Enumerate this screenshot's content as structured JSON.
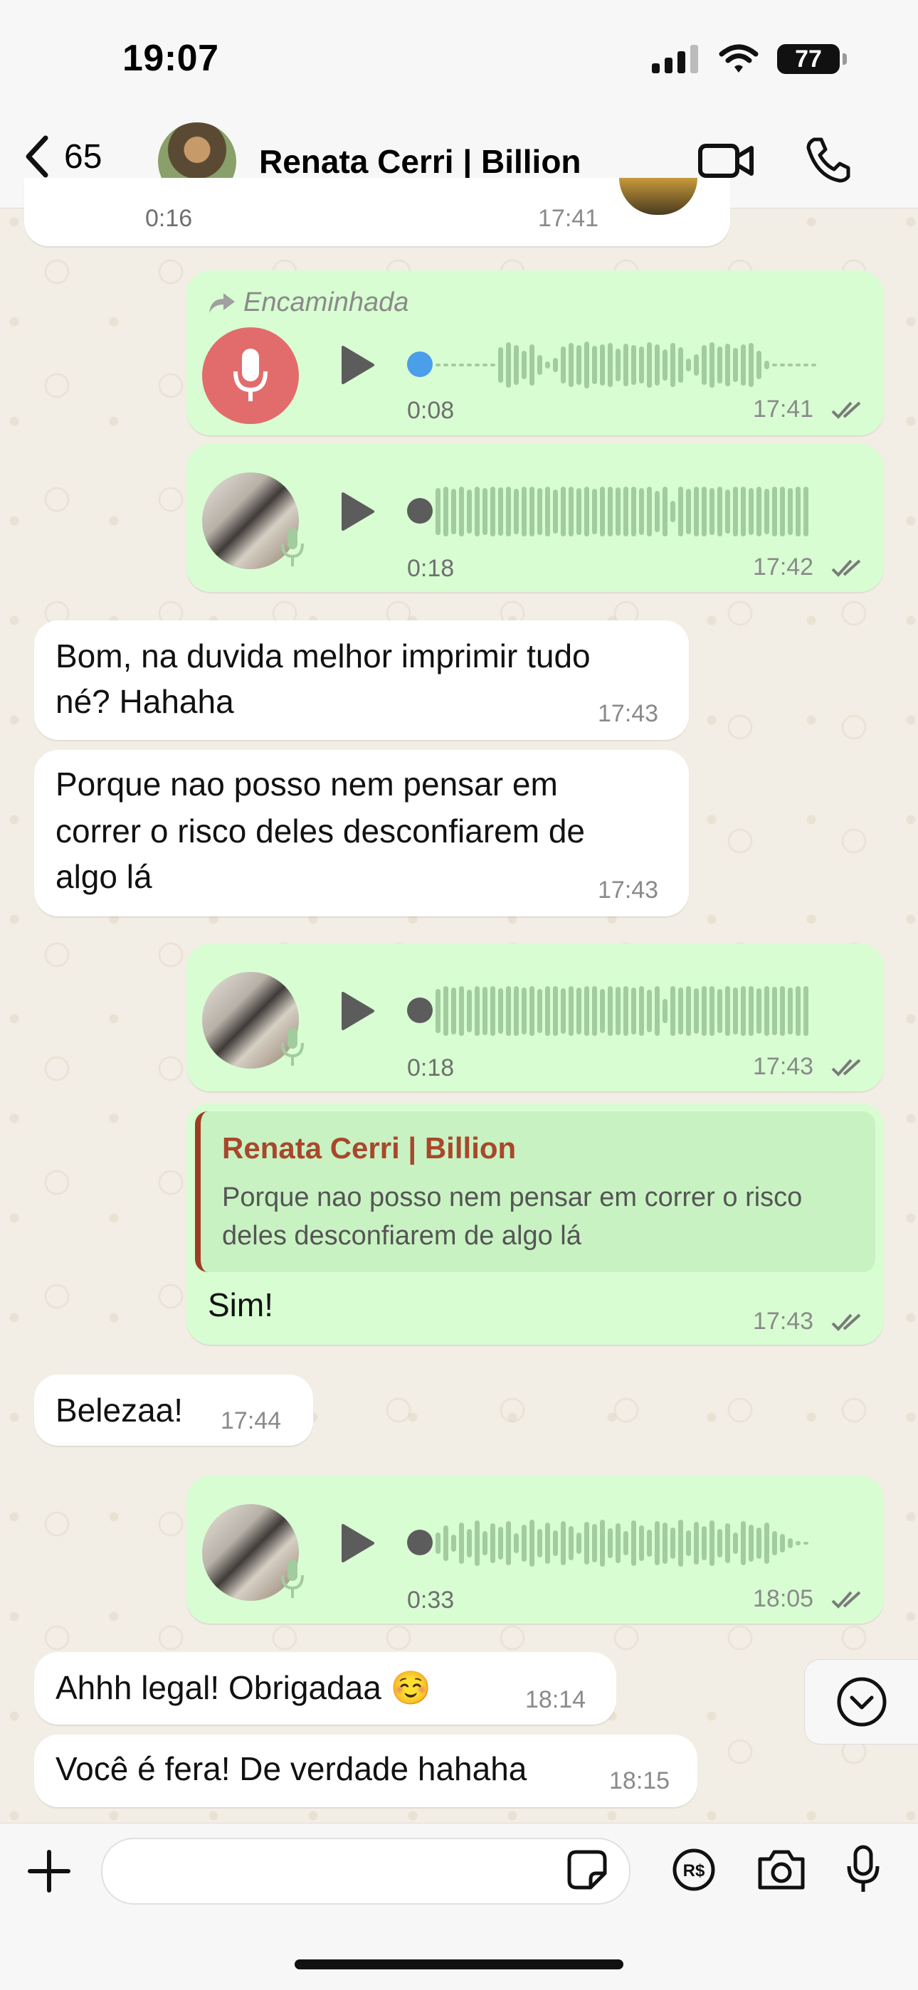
{
  "status_bar": {
    "time": "19:07",
    "battery": "77"
  },
  "header": {
    "back_count": "65",
    "contact_name": "Renata Cerri | Billion"
  },
  "messages": {
    "m0": {
      "duration": "0:16",
      "time": "17:41"
    },
    "m1": {
      "forwarded_label": "Encaminhada",
      "duration": "0:08",
      "time": "17:41"
    },
    "m2": {
      "duration": "0:18",
      "time": "17:42"
    },
    "m3": {
      "text_line1": "Bom, na duvida melhor imprimir tudo",
      "text_line2": "né? Hahaha",
      "time": "17:43"
    },
    "m4": {
      "text_line1": "Porque nao posso nem pensar em",
      "text_line2": "correr o risco deles desconfiarem de",
      "text_line3": "algo lá",
      "time": "17:43"
    },
    "m5": {
      "duration": "0:18",
      "time": "17:43"
    },
    "m6": {
      "quote_author": "Renata Cerri | Billion",
      "quote_line1": "Porque nao posso nem pensar em correr o risco",
      "quote_line2": "deles desconfiarem de algo lá",
      "text": "Sim!",
      "time": "17:43"
    },
    "m7": {
      "text": "Belezaa!",
      "time": "17:44"
    },
    "m8": {
      "duration": "0:33",
      "time": "18:05"
    },
    "m9": {
      "text": "Ahhh legal! Obrigadaa ☺️",
      "time": "18:14"
    },
    "m10": {
      "text": "Você é fera! De verdade hahaha",
      "time": "18:15"
    }
  },
  "composer": {
    "placeholder": ""
  },
  "colors": {
    "outgoing": "#d8fdd2",
    "incoming": "#ffffff",
    "accent_blue": "#4a9eea",
    "mic_red": "#e26c6c"
  },
  "icons": [
    "chevron-left-icon",
    "video-call-icon",
    "phone-icon",
    "play-icon",
    "mic-icon",
    "forward-arrow-icon",
    "double-check-icon",
    "plus-icon",
    "sticker-icon",
    "pix-payment-icon",
    "camera-icon",
    "chevron-down-icon"
  ]
}
